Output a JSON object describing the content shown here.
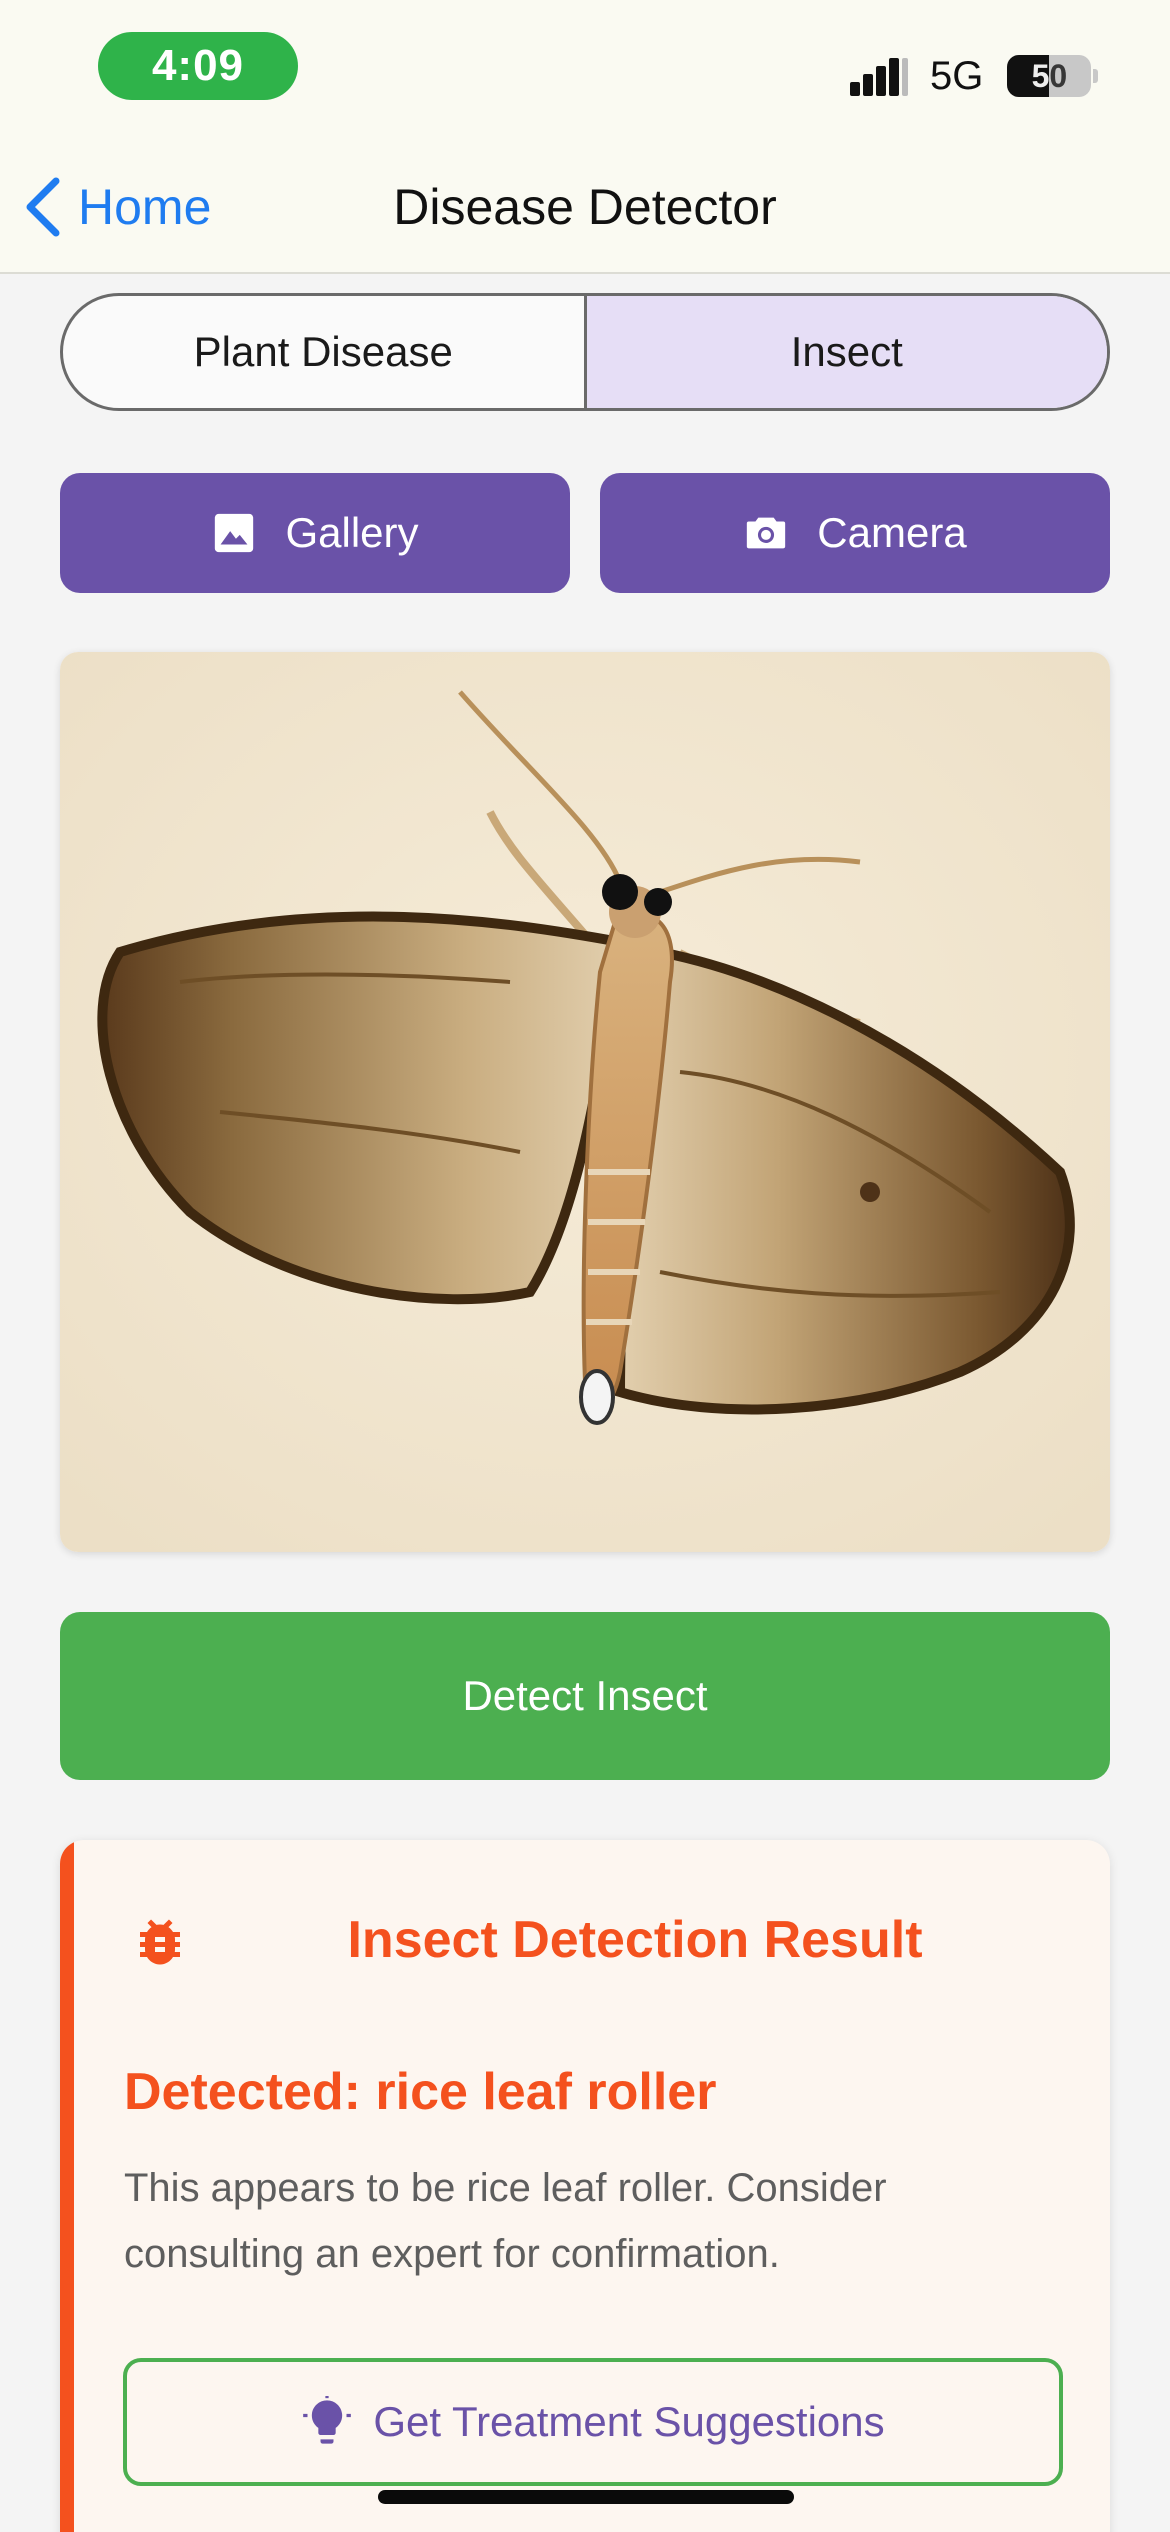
{
  "status_bar": {
    "time": "4:09",
    "network": "5G",
    "battery_percent": "50",
    "battery_level": 0.5,
    "icons": [
      "signal-icon",
      "battery-icon"
    ]
  },
  "nav": {
    "back_label": "Home",
    "back_icon": "chevron-left-icon",
    "title": "Disease Detector"
  },
  "segments": {
    "items": [
      "Plant Disease",
      "Insect"
    ],
    "selected": "Insect"
  },
  "pick": {
    "gallery_label": "Gallery",
    "gallery_icon": "image-icon",
    "camera_label": "Camera",
    "camera_icon": "camera-icon"
  },
  "photo": {
    "subject": "moth-photo"
  },
  "detect": {
    "label": "Detect Insect"
  },
  "result": {
    "icon": "bug-icon",
    "title": "Insect Detection Result",
    "detected": "Detected: rice leaf roller",
    "description": "This appears to be rice leaf roller. Consider consulting an expert for confirmation.",
    "treatment_label": "Get Treatment Suggestions",
    "treatment_icon": "lightbulb-icon"
  },
  "colors": {
    "accent_purple": "#6a52a8",
    "segment_selected": "#e6def6",
    "success_green": "#4caf50",
    "result_orange": "#f4511e",
    "time_pill_green": "#2fb34a",
    "link_blue": "#1f7cf0"
  }
}
